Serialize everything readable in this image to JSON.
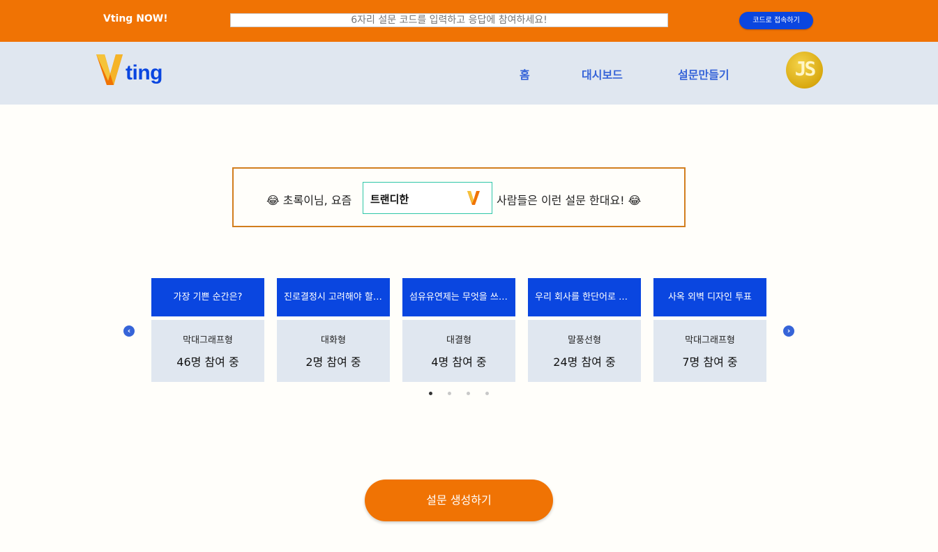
{
  "topbar": {
    "brand": "Vting NOW!",
    "code_placeholder": "6자리 설문 코드를 입력하고 응답에 참여하세요!",
    "connect_label": "코드로 접속하기",
    "color": "#f07304"
  },
  "navbar": {
    "logo_text": "ting",
    "items": [
      {
        "label": "홈"
      },
      {
        "label": "대시보드"
      },
      {
        "label": "설문만들기"
      }
    ],
    "avatar_text": "JS"
  },
  "trend": {
    "prefix": "😂 초록이님, 요즘",
    "selected": "트랜디한",
    "suffix": "사람들은 이런 설문 한대요! 😂"
  },
  "carousel": {
    "cards": [
      {
        "title": "가장 기쁜 순간은?",
        "type": "막대그래프형",
        "count": "46명 참여 중"
      },
      {
        "title": "진로결정시 고려해야 할 것은?",
        "type": "대화형",
        "count": "2명 참여 중"
      },
      {
        "title": "섬유유연제는 무엇을 쓰나요?",
        "type": "대결형",
        "count": "4명 참여 중"
      },
      {
        "title": "우리 회사를 한단어로 표현한다면?",
        "type": "말풍선형",
        "count": "24명 참여 중"
      },
      {
        "title": "사옥 외벽 디자인 투표",
        "type": "막대그래프형",
        "count": "7명 참여 중"
      }
    ],
    "pages": 4,
    "active_page": 1
  },
  "create_label": "설문 생성하기",
  "colors": {
    "primary": "#0a46e0",
    "accent": "#f07304",
    "panel": "#e0e7f0"
  }
}
